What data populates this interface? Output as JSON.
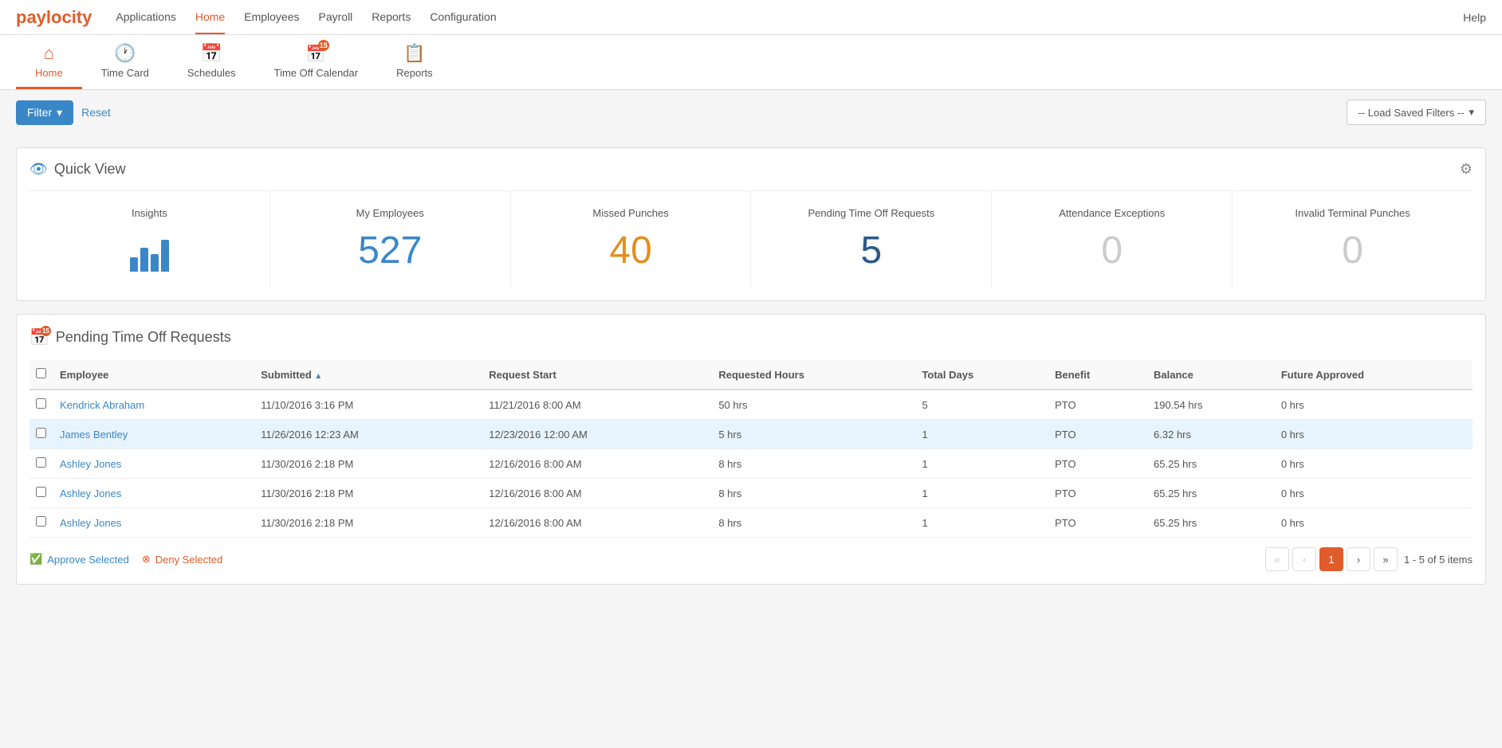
{
  "topNav": {
    "items": [
      {
        "label": "Applications",
        "active": false
      },
      {
        "label": "Home",
        "active": true
      },
      {
        "label": "Employees",
        "active": false
      },
      {
        "label": "Payroll",
        "active": false
      },
      {
        "label": "Reports",
        "active": false
      },
      {
        "label": "Configuration",
        "active": false
      }
    ],
    "help": "Help"
  },
  "subNav": {
    "items": [
      {
        "label": "Home",
        "icon": "🏠",
        "active": true
      },
      {
        "label": "Time Card",
        "icon": "🕐",
        "active": false
      },
      {
        "label": "Schedules",
        "icon": "📅",
        "active": false
      },
      {
        "label": "Time Off Calendar",
        "icon": "📅",
        "active": false,
        "badge": "15"
      },
      {
        "label": "Reports",
        "icon": "📋",
        "active": false
      }
    ]
  },
  "filterBar": {
    "filterLabel": "Filter",
    "resetLabel": "Reset",
    "loadSavedFilters": "-- Load Saved Filters --"
  },
  "quickView": {
    "title": "Quick View",
    "stats": [
      {
        "label": "Insights",
        "value": "",
        "type": "chart"
      },
      {
        "label": "My Employees",
        "value": "527",
        "type": "blue"
      },
      {
        "label": "Missed Punches",
        "value": "40",
        "type": "orange"
      },
      {
        "label": "Pending Time Off Requests",
        "value": "5",
        "type": "dark-blue"
      },
      {
        "label": "Attendance Exceptions",
        "value": "0",
        "type": "gray"
      },
      {
        "label": "Invalid Terminal Punches",
        "value": "0",
        "type": "gray"
      }
    ]
  },
  "pendingSection": {
    "title": "Pending Time Off Requests",
    "columns": [
      {
        "label": "Employee",
        "sortable": false
      },
      {
        "label": "Submitted",
        "sortable": true
      },
      {
        "label": "Request Start",
        "sortable": false
      },
      {
        "label": "Requested Hours",
        "sortable": false
      },
      {
        "label": "Total Days",
        "sortable": false
      },
      {
        "label": "Benefit",
        "sortable": false
      },
      {
        "label": "Balance",
        "sortable": false
      },
      {
        "label": "Future Approved",
        "sortable": false
      }
    ],
    "rows": [
      {
        "employee": "Kendrick Abraham",
        "submitted": "11/10/2016 3:16 PM",
        "requestStart": "11/21/2016 8:00 AM",
        "requestedHours": "50 hrs",
        "totalDays": "5",
        "benefit": "PTO",
        "balance": "190.54 hrs",
        "futureApproved": "0 hrs",
        "highlighted": false
      },
      {
        "employee": "James Bentley",
        "submitted": "11/26/2016 12:23 AM",
        "requestStart": "12/23/2016 12:00 AM",
        "requestedHours": "5 hrs",
        "totalDays": "1",
        "benefit": "PTO",
        "balance": "6.32 hrs",
        "futureApproved": "0 hrs",
        "highlighted": true
      },
      {
        "employee": "Ashley Jones",
        "submitted": "11/30/2016 2:18 PM",
        "requestStart": "12/16/2016 8:00 AM",
        "requestedHours": "8 hrs",
        "totalDays": "1",
        "benefit": "PTO",
        "balance": "65.25 hrs",
        "futureApproved": "0 hrs",
        "highlighted": false
      },
      {
        "employee": "Ashley Jones",
        "submitted": "11/30/2016 2:18 PM",
        "requestStart": "12/16/2016 8:00 AM",
        "requestedHours": "8 hrs",
        "totalDays": "1",
        "benefit": "PTO",
        "balance": "65.25 hrs",
        "futureApproved": "0 hrs",
        "highlighted": false
      },
      {
        "employee": "Ashley Jones",
        "submitted": "11/30/2016 2:18 PM",
        "requestStart": "12/16/2016 8:00 AM",
        "requestedHours": "8 hrs",
        "totalDays": "1",
        "benefit": "PTO",
        "balance": "65.25 hrs",
        "futureApproved": "0 hrs",
        "highlighted": false
      }
    ],
    "approveLabel": "Approve Selected",
    "denyLabel": "Deny Selected",
    "pagination": {
      "current": 1,
      "total": 1,
      "itemsInfo": "1 - 5 of 5 items"
    }
  }
}
